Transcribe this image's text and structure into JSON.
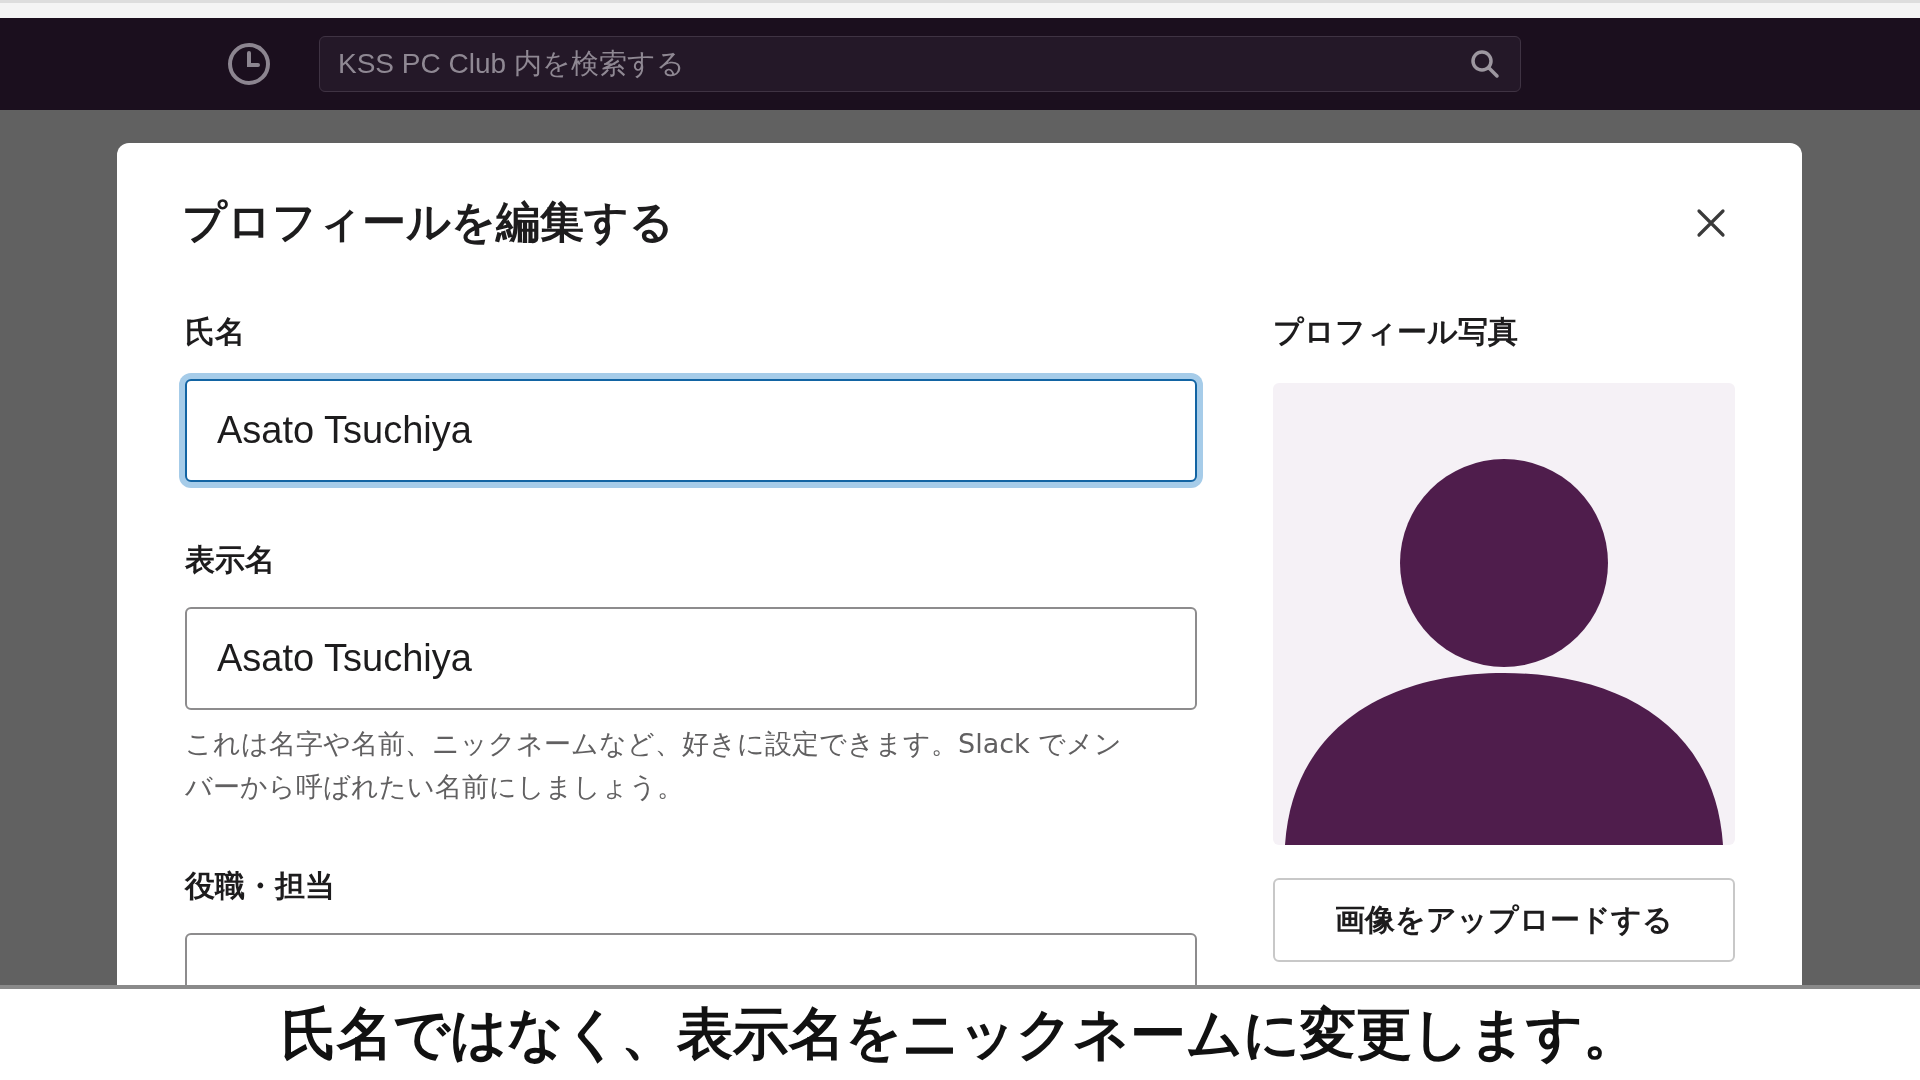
{
  "top_bar": {
    "search": {
      "placeholder": "KSS PC Club 内を検索する"
    }
  },
  "dialog": {
    "title": "プロフィールを編集する",
    "fields": [
      {
        "label": "氏名",
        "value": "Asato Tsuchiya",
        "focused": true
      },
      {
        "label": "表示名",
        "value": "Asato Tsuchiya",
        "focused": false,
        "help": "これは名字や名前、ニックネームなど、好きに設定できます。Slack でメンバーから呼ばれたい名前にしましょう。"
      },
      {
        "label": "役職・担当",
        "focused": false
      }
    ],
    "photo": {
      "label": "プロフィール写真",
      "upload_button": "画像をアップロードする"
    }
  },
  "caption": "氏名ではなく、表示名をニックネームに変更します。"
}
